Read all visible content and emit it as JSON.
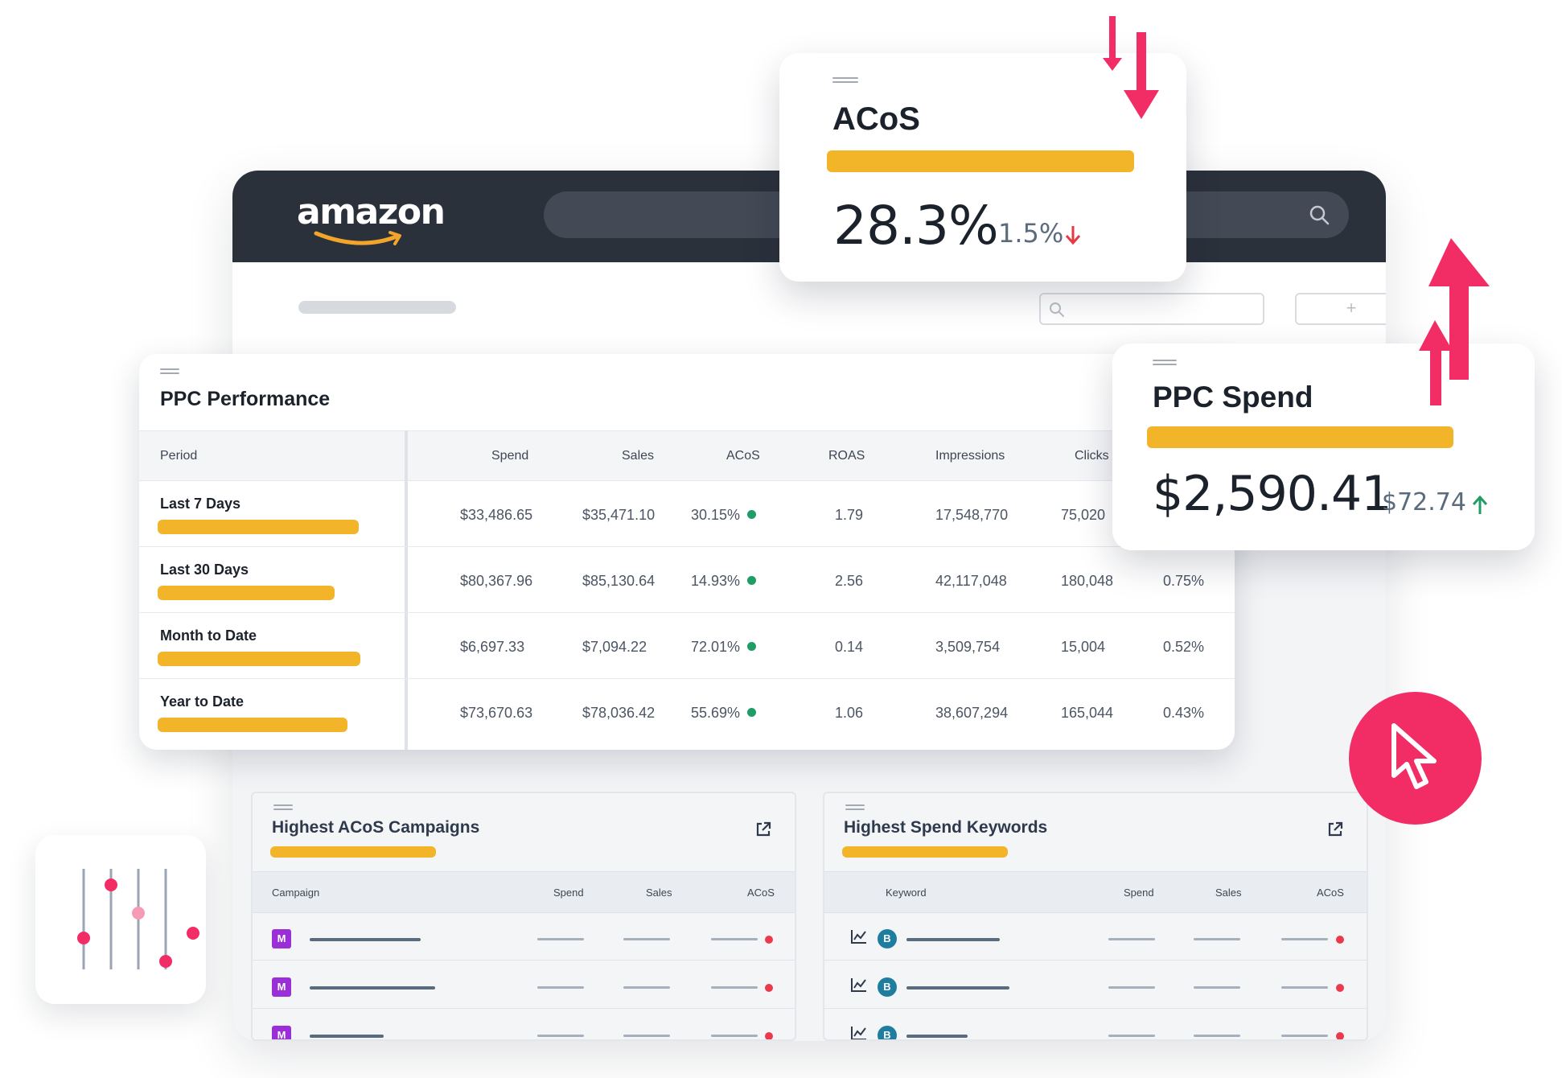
{
  "header": {
    "logo_text": "amazon"
  },
  "acos_card": {
    "title": "ACoS",
    "value": "28.3%",
    "change": "1.5%",
    "change_direction": "down",
    "change_color": "#e63946"
  },
  "spend_card": {
    "title": "PPC Spend",
    "value": "$2,590.41",
    "change": "$72.74",
    "change_direction": "up",
    "change_color": "#1f9d67"
  },
  "ppc_performance": {
    "title": "PPC Performance",
    "columns": [
      "Period",
      "Spend",
      "Sales",
      "ACoS",
      "ROAS",
      "Impressions",
      "Clicks"
    ],
    "rows": [
      {
        "period": "Last 7 Days",
        "spend": "$33,486.65",
        "sales": "$35,471.10",
        "acos": "30.15%",
        "roas": "1.79",
        "impressions": "17,548,770",
        "clicks": "75,020",
        "ctr": ""
      },
      {
        "period": "Last 30 Days",
        "spend": "$80,367.96",
        "sales": "$85,130.64",
        "acos": "14.93%",
        "roas": "2.56",
        "impressions": "42,117,048",
        "clicks": "180,048",
        "ctr": "0.75%"
      },
      {
        "period": "Month to Date",
        "spend": "$6,697.33",
        "sales": "$7,094.22",
        "acos": "72.01%",
        "roas": "0.14",
        "impressions": "3,509,754",
        "clicks": "15,004",
        "ctr": "0.52%"
      },
      {
        "period": "Year to Date",
        "spend": "$73,670.63",
        "sales": "$78,036.42",
        "acos": "55.69%",
        "roas": "1.06",
        "impressions": "38,607,294",
        "clicks": "165,044",
        "ctr": "0.43%"
      }
    ]
  },
  "campaigns_panel": {
    "title": "Highest ACoS Campaigns",
    "columns": [
      "Campaign",
      "Spend",
      "Sales",
      "ACoS"
    ],
    "badge": "M"
  },
  "keywords_panel": {
    "title": "Highest Spend Keywords",
    "columns": [
      "Keyword",
      "Spend",
      "Sales",
      "ACoS"
    ],
    "badge": "B"
  },
  "sub_toolbar": {
    "add_label": "+"
  },
  "colors": {
    "accent_bar": "#f2b428",
    "arrow_pink": "#f22d66",
    "topbar": "#2b313b",
    "status_green": "#1f9d67",
    "status_red": "#ec3a4d"
  }
}
